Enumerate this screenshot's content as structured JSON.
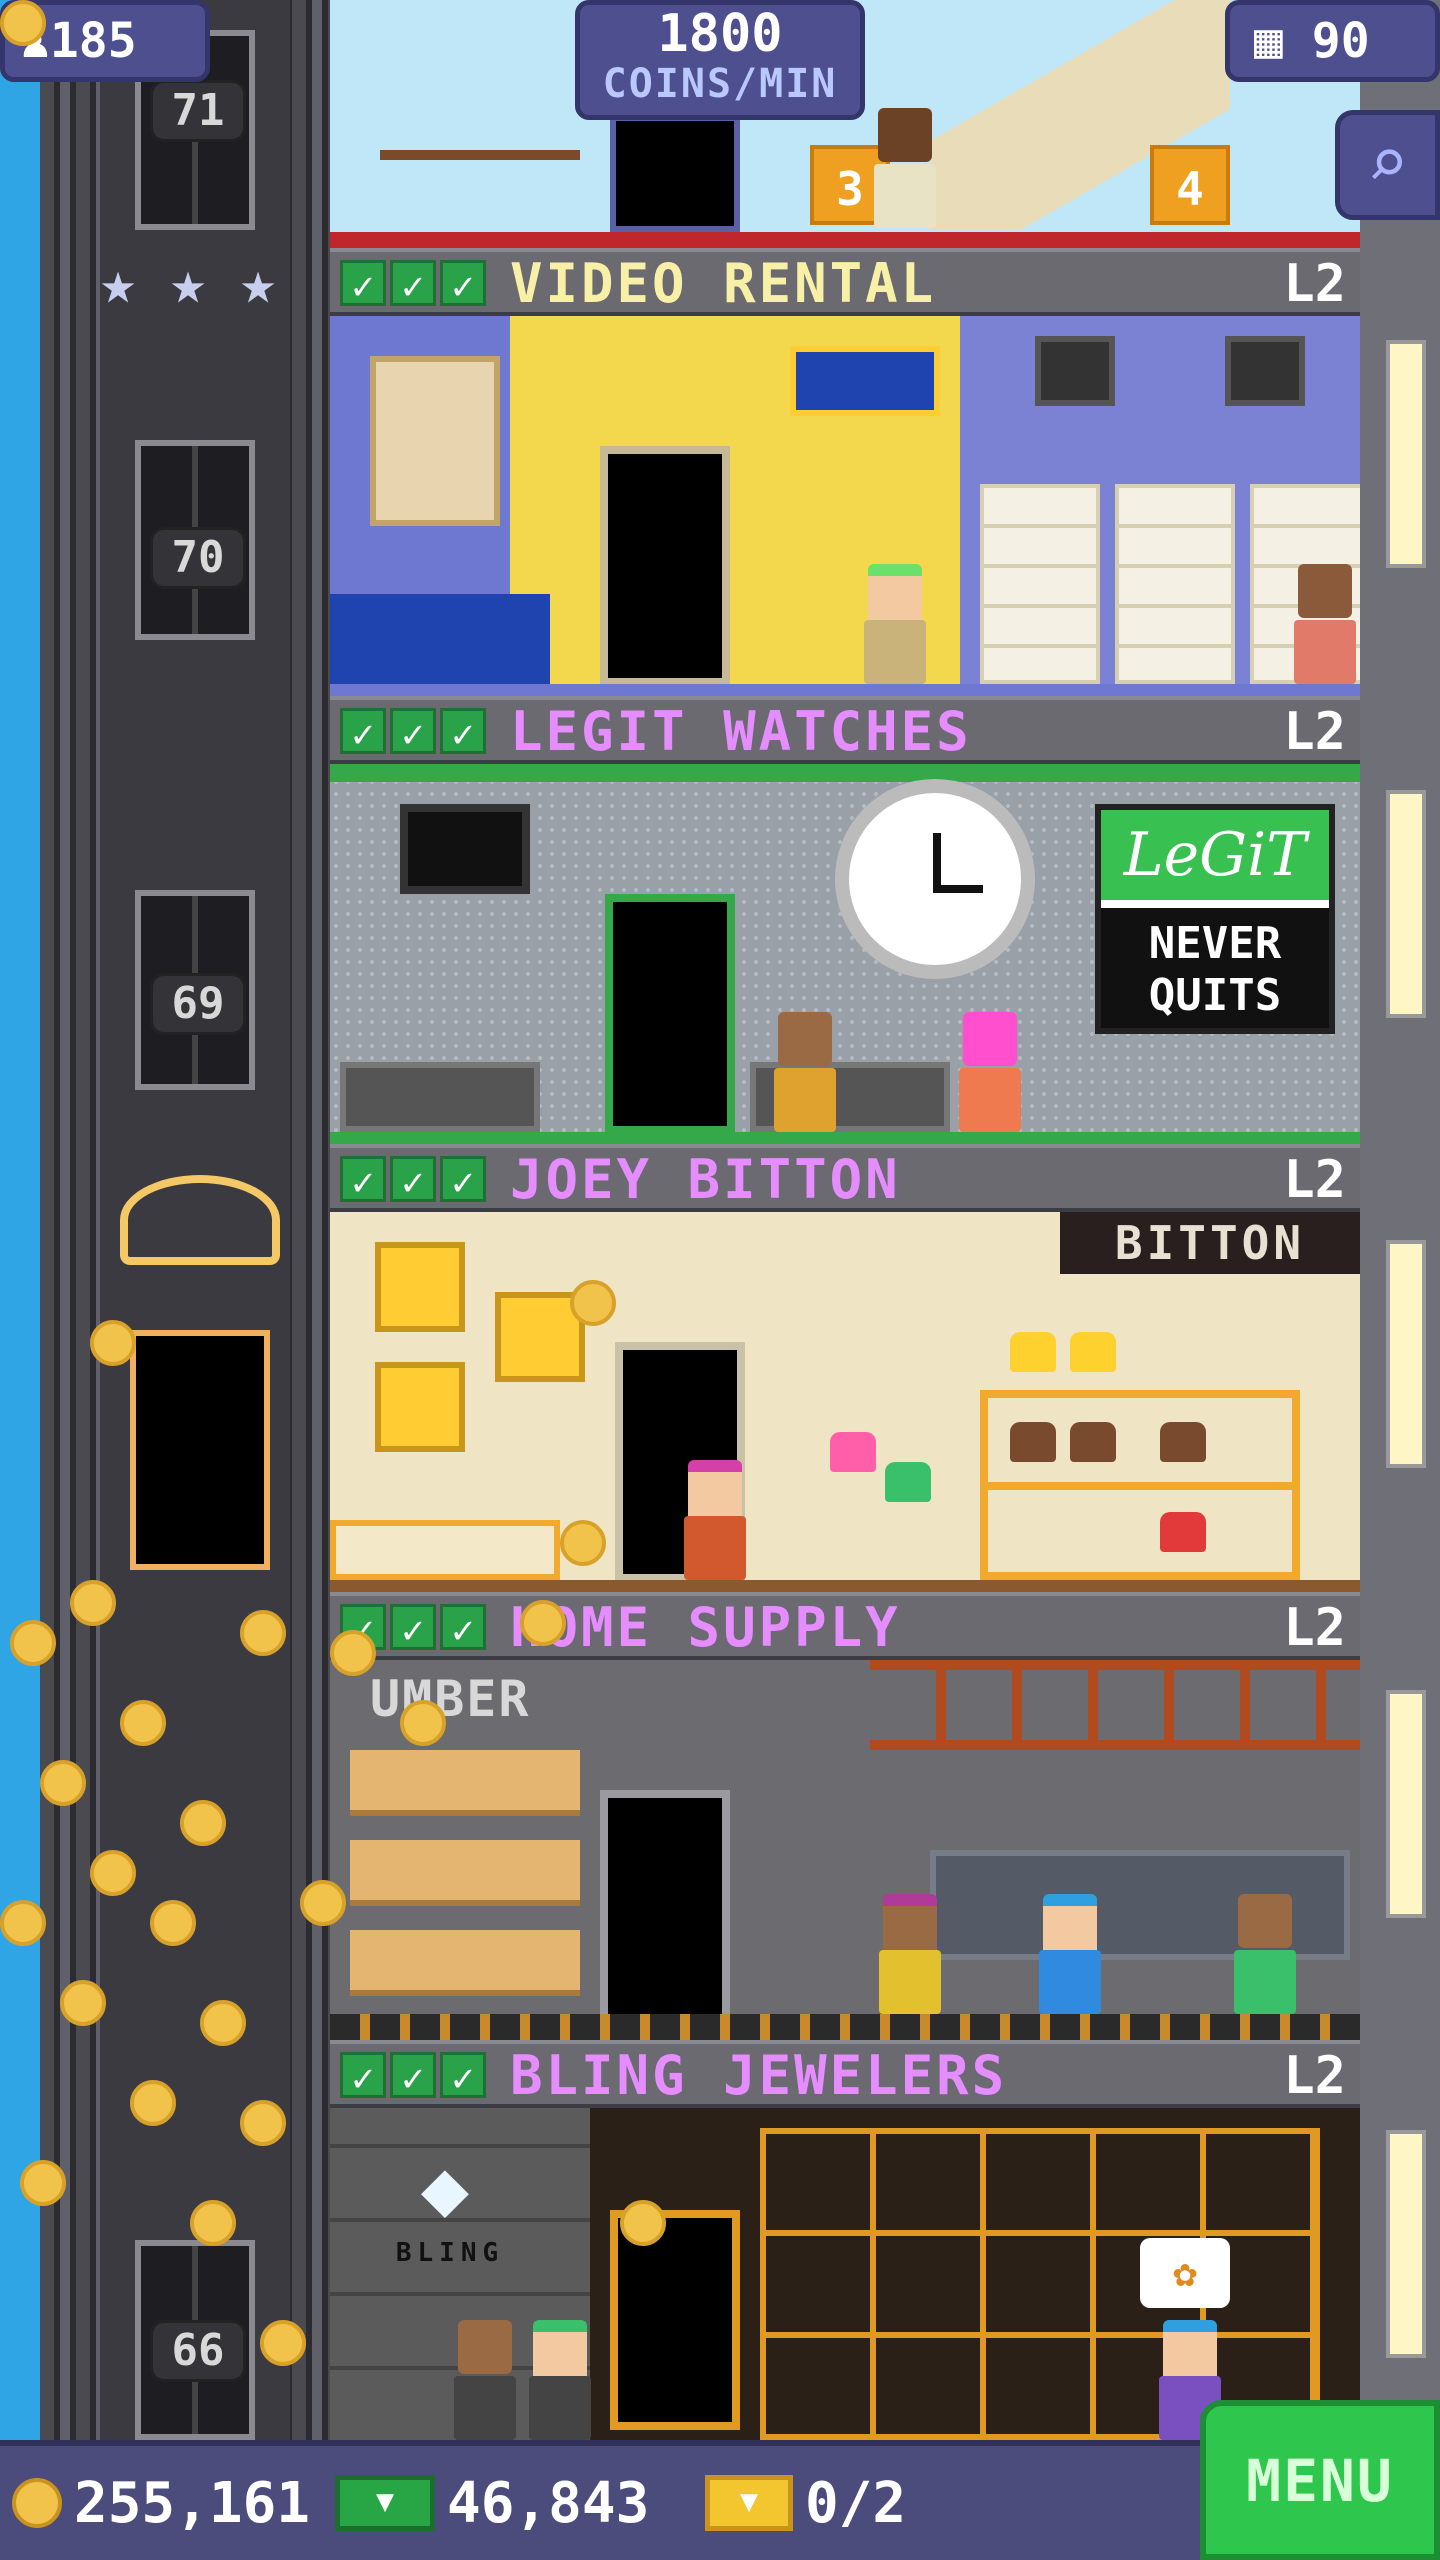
{
  "hud": {
    "population": "185",
    "coins_per_min_value": "1800",
    "coins_per_min_unit": "COINS/MIN",
    "floors": "90"
  },
  "shaft": {
    "floor_numbers": [
      "71",
      "70",
      "69",
      "66"
    ],
    "stars_count": 3
  },
  "top_floor": {
    "sign_a": "3",
    "sign_b": "4"
  },
  "floors": [
    {
      "name": "VIDEO RENTAL",
      "level": "L2",
      "checks": 3,
      "name_color": "#f7f0a6"
    },
    {
      "name": "LEGIT WATCHES",
      "level": "L2",
      "checks": 3,
      "name_color": "#e58cff"
    },
    {
      "name": "JOEY BITTON",
      "level": "L2",
      "checks": 3,
      "name_color": "#e58cff"
    },
    {
      "name": "HOME SUPPLY",
      "level": "L2",
      "checks": 3,
      "name_color": "#e58cff"
    },
    {
      "name": "BLING JEWELERS",
      "level": "L2",
      "checks": 3,
      "name_color": "#e58cff"
    }
  ],
  "legit": {
    "brand": "LeGiT",
    "tag_line1": "NEVER",
    "tag_line2": "QUITS"
  },
  "bitton": {
    "banner": "BITTON"
  },
  "home_supply": {
    "sign": "UMBER"
  },
  "bling": {
    "brand": "BLING"
  },
  "bottom": {
    "coins": "255,161",
    "bux": "46,843",
    "tickets": "0/2",
    "menu_label": "MENU"
  },
  "colors": {
    "hud_bg": "#4e4f8f",
    "menu_green": "#2ec64d",
    "check_green": "#2aa24a",
    "coin_gold": "#f2c34a"
  },
  "icons": {
    "population": "person-icon",
    "floors": "building-icon",
    "search": "magnifier-icon",
    "coin": "coin-icon",
    "bux": "bux-icon",
    "ticket": "ticket-icon",
    "star": "star-icon"
  }
}
